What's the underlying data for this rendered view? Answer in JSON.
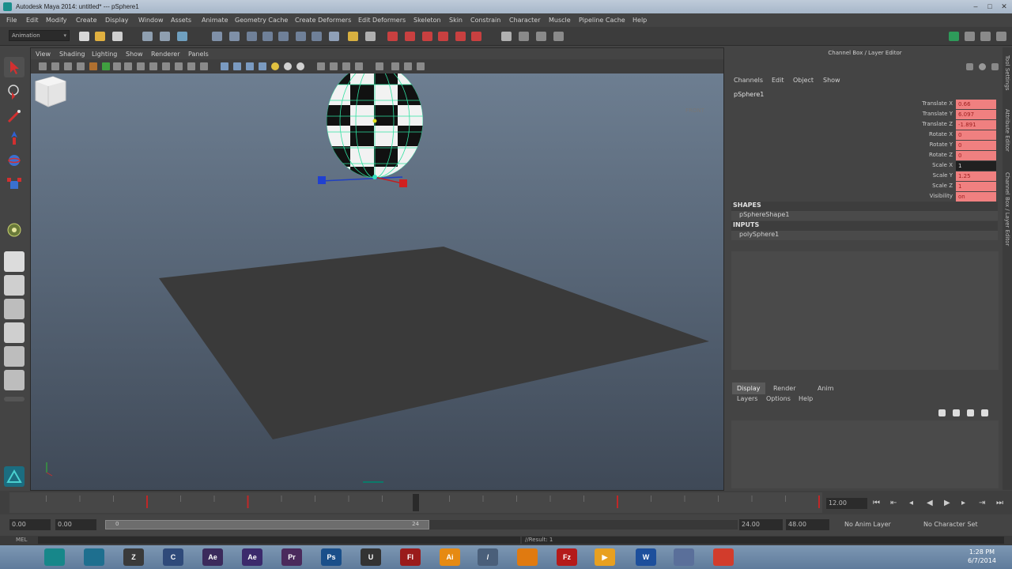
{
  "window": {
    "title": "Autodesk Maya 2014: untitled*  ---  pSphere1"
  },
  "menubar": [
    "File",
    "Edit",
    "Modify",
    "Create",
    "Display",
    "Window",
    "Assets",
    "Animate",
    "Geometry Cache",
    "Create Deformers",
    "Edit Deformers",
    "Skeleton",
    "Skin",
    "Constrain",
    "Character",
    "Muscle",
    "Pipeline Cache",
    "Help"
  ],
  "status_line": {
    "mode": "Animation"
  },
  "viewport": {
    "menus": [
      "View",
      "Shading",
      "Lighting",
      "Show",
      "Renderer",
      "Panels"
    ],
    "view_cube_label": "FRONT"
  },
  "channel_box": {
    "header": "Channel Box / Layer Editor",
    "menus": [
      "Channels",
      "Edit",
      "Object",
      "Show"
    ],
    "object_name": "pSphere1",
    "attributes": [
      {
        "label": "Translate X",
        "value": "0.66"
      },
      {
        "label": "Translate Y",
        "value": "6.097"
      },
      {
        "label": "Translate Z",
        "value": "-1.891"
      },
      {
        "label": "Rotate X",
        "value": "0"
      },
      {
        "label": "Rotate Y",
        "value": "0"
      },
      {
        "label": "Rotate Z",
        "value": "0"
      },
      {
        "label": "Scale X",
        "value": "1"
      },
      {
        "label": "Scale Y",
        "value": "1.25"
      },
      {
        "label": "Scale Z",
        "value": "1"
      },
      {
        "label": "Visibility",
        "value": "on"
      }
    ],
    "shapes_header": "SHAPES",
    "shape_node": "pSphereShape1",
    "inputs_header": "INPUTS",
    "input_node": "polySphere1"
  },
  "layer_editor": {
    "tabs": [
      "Display",
      "Render",
      "Anim"
    ],
    "menus": [
      "Layers",
      "Options",
      "Help"
    ]
  },
  "side_tabs": [
    "Tool Settings",
    "Attribute Editor",
    "Channel Box / Layer Editor"
  ],
  "time_slider": {
    "current_time": "12.00",
    "start": 1,
    "end": 24,
    "current_frame": 12,
    "keyframes": [
      4,
      7,
      18,
      24
    ]
  },
  "range_slider": {
    "start_time": "0.00",
    "playback_start": "0.00",
    "handle_start": "0",
    "handle_end": "24",
    "playback_end": "24.00",
    "end_time": "48.00",
    "anim_layer": "No Anim Layer",
    "character_set": "No Character Set"
  },
  "command_line": {
    "label": "MEL",
    "result": "//Result: 1"
  },
  "taskbar": {
    "apps": [
      {
        "name": "Maya",
        "label": "",
        "color": "#17878a"
      },
      {
        "name": "Maya 2014",
        "label": "",
        "color": "#1e6f8f"
      },
      {
        "name": "ZBrush",
        "label": "Z",
        "color": "#3a3a3a"
      },
      {
        "name": "Cinema 4D",
        "label": "C",
        "color": "#2f4a7a"
      },
      {
        "name": "After Effects",
        "label": "Ae",
        "color": "#3b2a5c"
      },
      {
        "name": "Premiere",
        "label": "Ae",
        "color": "#3b2a6c"
      },
      {
        "name": "Premiere Pro",
        "label": "Pr",
        "color": "#4a2a5c"
      },
      {
        "name": "Photoshop",
        "label": "Ps",
        "color": "#1a4f8a"
      },
      {
        "name": "Unity",
        "label": "U",
        "color": "#333333"
      },
      {
        "name": "Flash",
        "label": "Fl",
        "color": "#9a1b1b"
      },
      {
        "name": "Illustrator",
        "label": "Ai",
        "color": "#e68a12"
      },
      {
        "name": "Inkscape",
        "label": "/",
        "color": "#4a5f7a"
      },
      {
        "name": "VLC",
        "label": "",
        "color": "#e07a10"
      },
      {
        "name": "FileZilla",
        "label": "Fz",
        "color": "#b41a1a"
      },
      {
        "name": "Media Player",
        "label": "▶",
        "color": "#e8a020"
      },
      {
        "name": "Word",
        "label": "W",
        "color": "#1d4f9c"
      },
      {
        "name": "Save",
        "label": "",
        "color": "#5a6f9a"
      },
      {
        "name": "Chrome",
        "label": "",
        "color": "#d23c2c"
      }
    ],
    "clock_time": "1:28 PM",
    "clock_date": "6/7/2014"
  },
  "colors": {
    "attr_keyed": "#f08080",
    "viewport_top": "#6d7e91",
    "viewport_bottom": "#3f4957",
    "accent": "#17878a"
  }
}
